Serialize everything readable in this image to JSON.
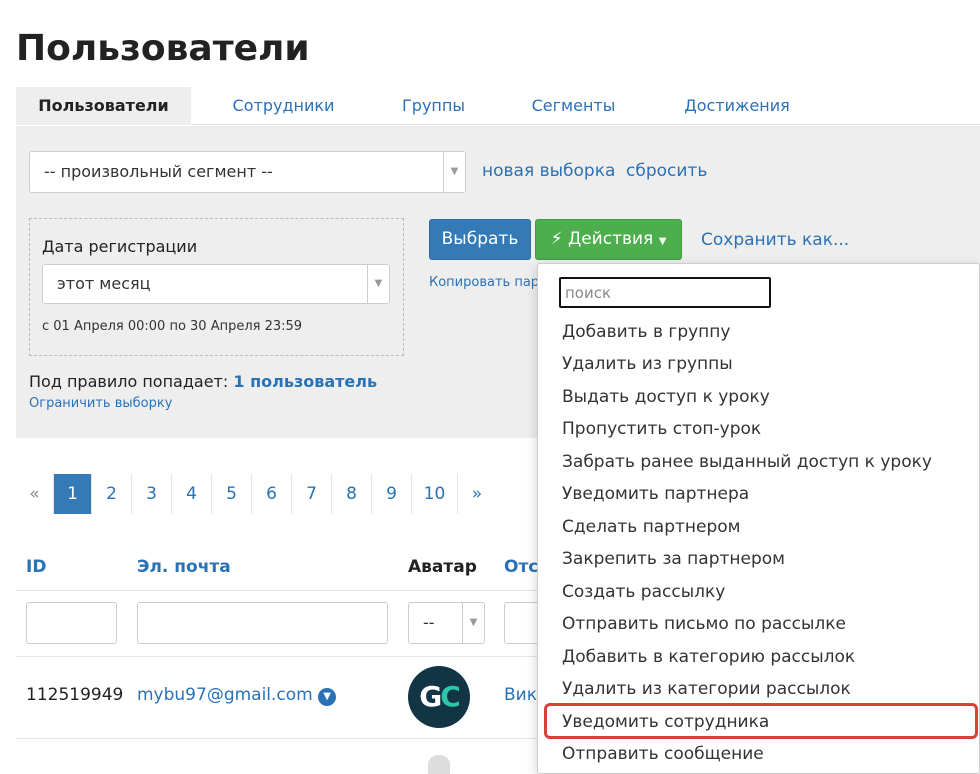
{
  "page": {
    "title": "Пользователи"
  },
  "tabs": [
    "Пользователи",
    "Сотрудники",
    "Группы",
    "Сегменты",
    "Достижения"
  ],
  "filter": {
    "segment_value": "-- произвольный сегмент --",
    "new_selection": "новая выборка",
    "reset": "сбросить",
    "date_label": "Дата регистрации",
    "date_value": "этот месяц",
    "date_range": "с 01 Апреля 00:00 по 30 Апреля 23:59",
    "choose_button": "Выбрать",
    "actions_button": "Действия",
    "save_as": "Сохранить как...",
    "copy_params": "Копировать пара",
    "rule_prefix": "Под правило попадает:",
    "rule_count": "1 пользователь",
    "limit_selection": "Ограничить выборку"
  },
  "pagination": {
    "prev": "«",
    "pages": [
      "1",
      "2",
      "3",
      "4",
      "5",
      "6",
      "7",
      "8",
      "9",
      "10"
    ],
    "next": "»",
    "current": "1"
  },
  "table": {
    "headers": {
      "id": "ID",
      "email": "Эл. почта",
      "avatar": "Аватар",
      "other": "Отс"
    },
    "avatar_filter_value": "--",
    "rows": [
      {
        "id": "112519949",
        "email": "mybu97@gmail.com",
        "avatar_text": "GC",
        "other": "Викт"
      }
    ]
  },
  "dropdown": {
    "search_placeholder": "поиск",
    "items": [
      "Добавить в группу",
      "Удалить из группы",
      "Выдать доступ к уроку",
      "Пропустить стоп-урок",
      "Забрать ранее выданный доступ к уроку",
      "Уведомить партнера",
      "Сделать партнером",
      "Закрепить за партнером",
      "Создать рассылку",
      "Отправить письмо по рассылке",
      "Добавить в категорию рассылок",
      "Удалить из категории рассылок",
      "Уведомить сотрудника",
      "Отправить сообщение"
    ],
    "highlighted": "Уведомить сотрудника"
  },
  "colors": {
    "link": "#2a72b5",
    "primary": "#337ab7",
    "success": "#4cae4c",
    "highlight": "#d9403a"
  },
  "icons": [
    "bolt-icon",
    "caret-down-icon",
    "verified-check-icon",
    "select-arrow-icon"
  ]
}
